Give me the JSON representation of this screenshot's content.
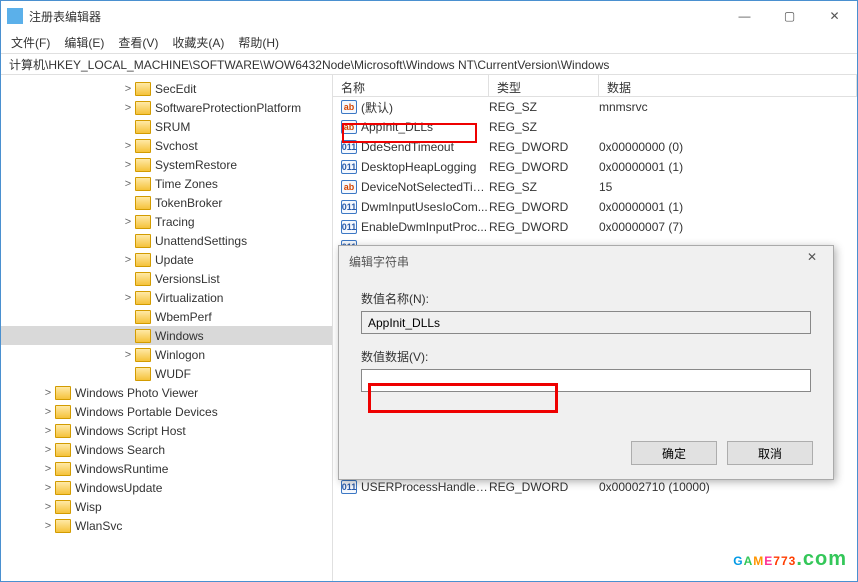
{
  "window": {
    "title": "注册表编辑器"
  },
  "win_controls": {
    "min": "—",
    "max": "▢",
    "close": "✕"
  },
  "menu": [
    "文件(F)",
    "编辑(E)",
    "查看(V)",
    "收藏夹(A)",
    "帮助(H)"
  ],
  "address": "计算机\\HKEY_LOCAL_MACHINE\\SOFTWARE\\WOW6432Node\\Microsoft\\Windows NT\\CurrentVersion\\Windows",
  "tree": [
    {
      "indent": 120,
      "exp": ">",
      "label": "SecEdit"
    },
    {
      "indent": 120,
      "exp": ">",
      "label": "SoftwareProtectionPlatform"
    },
    {
      "indent": 120,
      "exp": "",
      "label": "SRUM"
    },
    {
      "indent": 120,
      "exp": ">",
      "label": "Svchost"
    },
    {
      "indent": 120,
      "exp": ">",
      "label": "SystemRestore"
    },
    {
      "indent": 120,
      "exp": ">",
      "label": "Time Zones"
    },
    {
      "indent": 120,
      "exp": "",
      "label": "TokenBroker"
    },
    {
      "indent": 120,
      "exp": ">",
      "label": "Tracing"
    },
    {
      "indent": 120,
      "exp": "",
      "label": "UnattendSettings"
    },
    {
      "indent": 120,
      "exp": ">",
      "label": "Update"
    },
    {
      "indent": 120,
      "exp": "",
      "label": "VersionsList"
    },
    {
      "indent": 120,
      "exp": ">",
      "label": "Virtualization"
    },
    {
      "indent": 120,
      "exp": "",
      "label": "WbemPerf"
    },
    {
      "indent": 120,
      "exp": "",
      "label": "Windows",
      "sel": true
    },
    {
      "indent": 120,
      "exp": ">",
      "label": "Winlogon"
    },
    {
      "indent": 120,
      "exp": "",
      "label": "WUDF"
    },
    {
      "indent": 40,
      "exp": ">",
      "label": "Windows Photo Viewer"
    },
    {
      "indent": 40,
      "exp": ">",
      "label": "Windows Portable Devices"
    },
    {
      "indent": 40,
      "exp": ">",
      "label": "Windows Script Host"
    },
    {
      "indent": 40,
      "exp": ">",
      "label": "Windows Search"
    },
    {
      "indent": 40,
      "exp": ">",
      "label": "WindowsRuntime"
    },
    {
      "indent": 40,
      "exp": ">",
      "label": "WindowsUpdate"
    },
    {
      "indent": 40,
      "exp": ">",
      "label": "Wisp"
    },
    {
      "indent": 40,
      "exp": ">",
      "label": "WlanSvc"
    }
  ],
  "columns": {
    "name": "名称",
    "type": "类型",
    "data": "数据"
  },
  "rows": [
    {
      "ico": "ab",
      "name": "(默认)",
      "type": "REG_SZ",
      "data": "mnmsrvc"
    },
    {
      "ico": "ab",
      "name": "AppInit_DLLs",
      "type": "REG_SZ",
      "data": ""
    },
    {
      "ico": "bin",
      "name": "DdeSendTimeout",
      "type": "REG_DWORD",
      "data": "0x00000000 (0)"
    },
    {
      "ico": "bin",
      "name": "DesktopHeapLogging",
      "type": "REG_DWORD",
      "data": "0x00000001 (1)"
    },
    {
      "ico": "ab",
      "name": "DeviceNotSelectedTim...",
      "type": "REG_SZ",
      "data": "15"
    },
    {
      "ico": "bin",
      "name": "DwmInputUsesIoCom...",
      "type": "REG_DWORD",
      "data": "0x00000001 (1)"
    },
    {
      "ico": "bin",
      "name": "EnableDwmInputProc...",
      "type": "REG_DWORD",
      "data": "0x00000007 (7)"
    },
    {
      "ico": "bin",
      "name": "",
      "type": "",
      "data": ""
    },
    {
      "ico": "bin",
      "name": "",
      "type": "",
      "data": ""
    },
    {
      "ico": "bin",
      "name": "",
      "type": "",
      "data": ""
    },
    {
      "ico": "bin",
      "name": "",
      "type": "",
      "data": ""
    },
    {
      "ico": "ab",
      "name": "",
      "type": "",
      "data": ""
    },
    {
      "ico": "bin",
      "name": "",
      "type": "",
      "data": ""
    },
    {
      "ico": "ab",
      "name": "",
      "type": "",
      "data": ""
    },
    {
      "ico": "ab",
      "name": "",
      "type": "",
      "data": ""
    },
    {
      "ico": "bin",
      "name": "",
      "type": "",
      "data": ""
    },
    {
      "ico": "ab",
      "name": "",
      "type": "",
      "data": ""
    },
    {
      "ico": "ab",
      "name": "",
      "type": "",
      "data": ""
    },
    {
      "ico": "bin",
      "name": "",
      "type": "",
      "data": ""
    },
    {
      "ico": "bin",
      "name": "USERProcessHandleQ...",
      "type": "REG_DWORD",
      "data": "0x00002710 (10000)"
    }
  ],
  "dialog": {
    "title": "编辑字符串",
    "name_label": "数值名称(N):",
    "name_value": "AppInit_DLLs",
    "data_label": "数值数据(V):",
    "data_value": "",
    "ok": "确定",
    "cancel": "取消",
    "close": "✕"
  },
  "watermark": "GAME773.com"
}
